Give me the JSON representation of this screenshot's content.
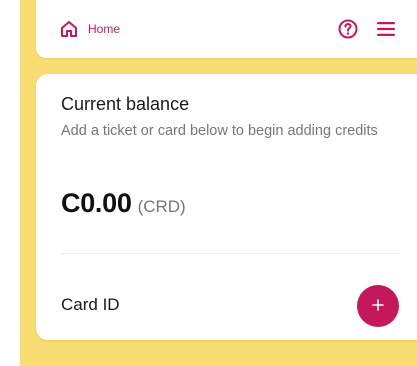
{
  "header": {
    "home_label": "Home",
    "icons": {
      "home": "home-icon",
      "help": "help-circle-icon",
      "menu": "hamburger-menu-icon"
    }
  },
  "balance_card": {
    "title": "Current balance",
    "description": "Add a ticket or card below to begin adding credits",
    "amount": "C0.00",
    "unit": "(CRD)",
    "card_id_label": "Card ID",
    "add_icon": "plus-icon"
  },
  "colors": {
    "accent": "#c4185b",
    "background": "#f8dd72",
    "surface": "#ffffff",
    "muted_text": "#767676"
  }
}
